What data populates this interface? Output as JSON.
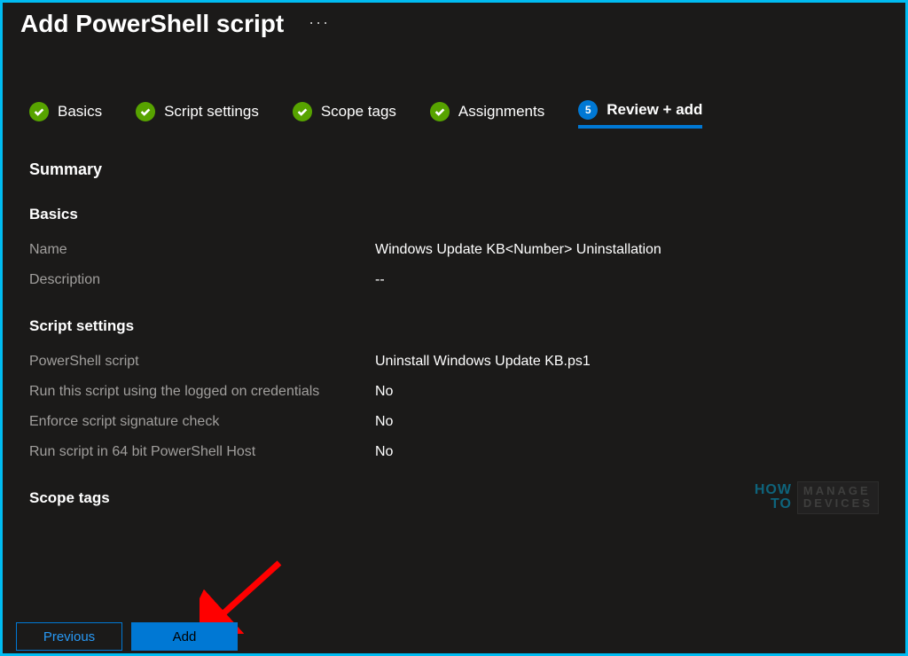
{
  "header": {
    "title": "Add PowerShell script",
    "more": "···"
  },
  "steps": [
    {
      "label": "Basics",
      "state": "done"
    },
    {
      "label": "Script settings",
      "state": "done"
    },
    {
      "label": "Scope tags",
      "state": "done"
    },
    {
      "label": "Assignments",
      "state": "done"
    },
    {
      "label": "Review + add",
      "state": "current",
      "number": "5"
    }
  ],
  "summary_heading": "Summary",
  "sections": {
    "basics": {
      "title": "Basics",
      "rows": [
        {
          "label": "Name",
          "value": "Windows Update KB<Number> Uninstallation"
        },
        {
          "label": "Description",
          "value": "--"
        }
      ]
    },
    "script_settings": {
      "title": "Script settings",
      "rows": [
        {
          "label": "PowerShell script",
          "value": "Uninstall Windows Update KB.ps1"
        },
        {
          "label": "Run this script using the logged on credentials",
          "value": "No"
        },
        {
          "label": "Enforce script signature check",
          "value": "No"
        },
        {
          "label": "Run script in 64 bit PowerShell Host",
          "value": "No"
        }
      ]
    },
    "scope_tags": {
      "title": "Scope tags"
    }
  },
  "footer": {
    "previous": "Previous",
    "add": "Add"
  },
  "watermark": {
    "how": "HOW",
    "to": "TO",
    "manage": "MANAGE",
    "devices": "DEVICES"
  }
}
